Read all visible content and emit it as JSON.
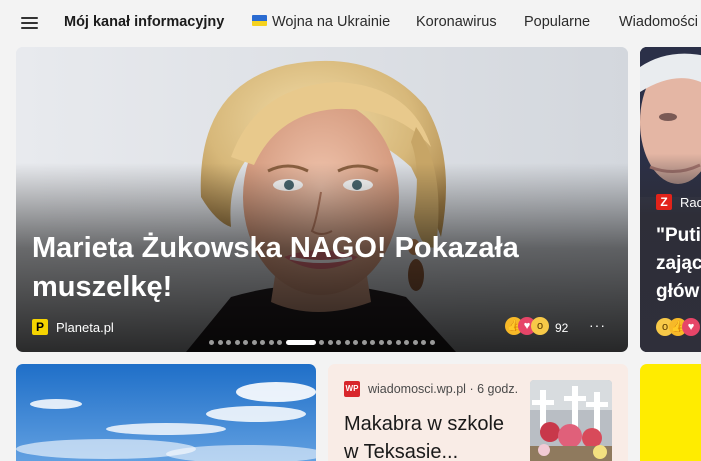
{
  "nav": {
    "title": "Mój kanał informacyjny",
    "tabs": [
      "Wojna na Ukrainie",
      "Koronawirus",
      "Popularne",
      "Wiadomości"
    ],
    "flag_colors": [
      "#2a6bd1",
      "#f5d21f"
    ]
  },
  "hero": {
    "title": "Marieta Żukowska NAGO! Pokazała muszelkę!",
    "source": "Planeta.pl",
    "source_logo_letter": "P",
    "reaction_icons": [
      "thumbs-up-icon",
      "heart-icon",
      "wow-icon"
    ],
    "reaction_count": "92",
    "more_label": "···",
    "carousel_total": 24,
    "carousel_active": 9
  },
  "peek": {
    "source": "Rad",
    "source_logo_letter": "Z",
    "title_lines": [
      "\"Puti",
      "zając",
      "głów"
    ],
    "reaction_icons": [
      "wow-icon",
      "thumbs-up-icon",
      "heart-icon"
    ]
  },
  "news": {
    "source": "wiadomosci.wp.pl",
    "age": "6 godz.",
    "title": "Makabra w szkole w Teksasie...",
    "logo_text": "WP"
  },
  "colors": {
    "background": "#f3f3f3",
    "news_card_bg": "#f9ece6",
    "yellow_card": "#ffec00",
    "wp_red": "#d8262b"
  }
}
